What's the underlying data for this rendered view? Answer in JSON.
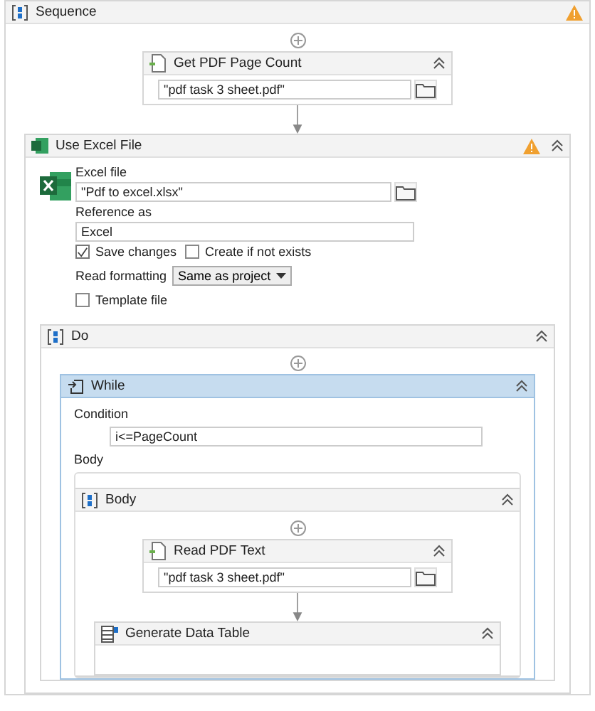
{
  "sequence": {
    "title": "Sequence",
    "warning": true
  },
  "get_pdf_page_count": {
    "title": "Get PDF Page Count",
    "file": "\"pdf task 3 sheet.pdf\""
  },
  "use_excel_file": {
    "title": "Use Excel File",
    "warning": true,
    "excel_file_label": "Excel file",
    "excel_file": "\"Pdf to excel.xlsx\"",
    "reference_label": "Reference as",
    "reference": "Excel",
    "options": [
      {
        "label": "Save changes",
        "checked": true
      },
      {
        "label": "Create if not exists",
        "checked": false
      }
    ],
    "read_formatting_label": "Read formatting",
    "read_formatting": "Same as project",
    "template": {
      "label": "Template file",
      "checked": false
    }
  },
  "do": {
    "title": "Do"
  },
  "while": {
    "title": "While",
    "selected": true,
    "condition_label": "Condition",
    "condition": "i<=PageCount",
    "body_label": "Body"
  },
  "body": {
    "title": "Body"
  },
  "read_pdf_text": {
    "title": "Read PDF Text",
    "file": "\"pdf task 3 sheet.pdf\""
  },
  "generate_data_table": {
    "title": "Generate Data Table"
  }
}
